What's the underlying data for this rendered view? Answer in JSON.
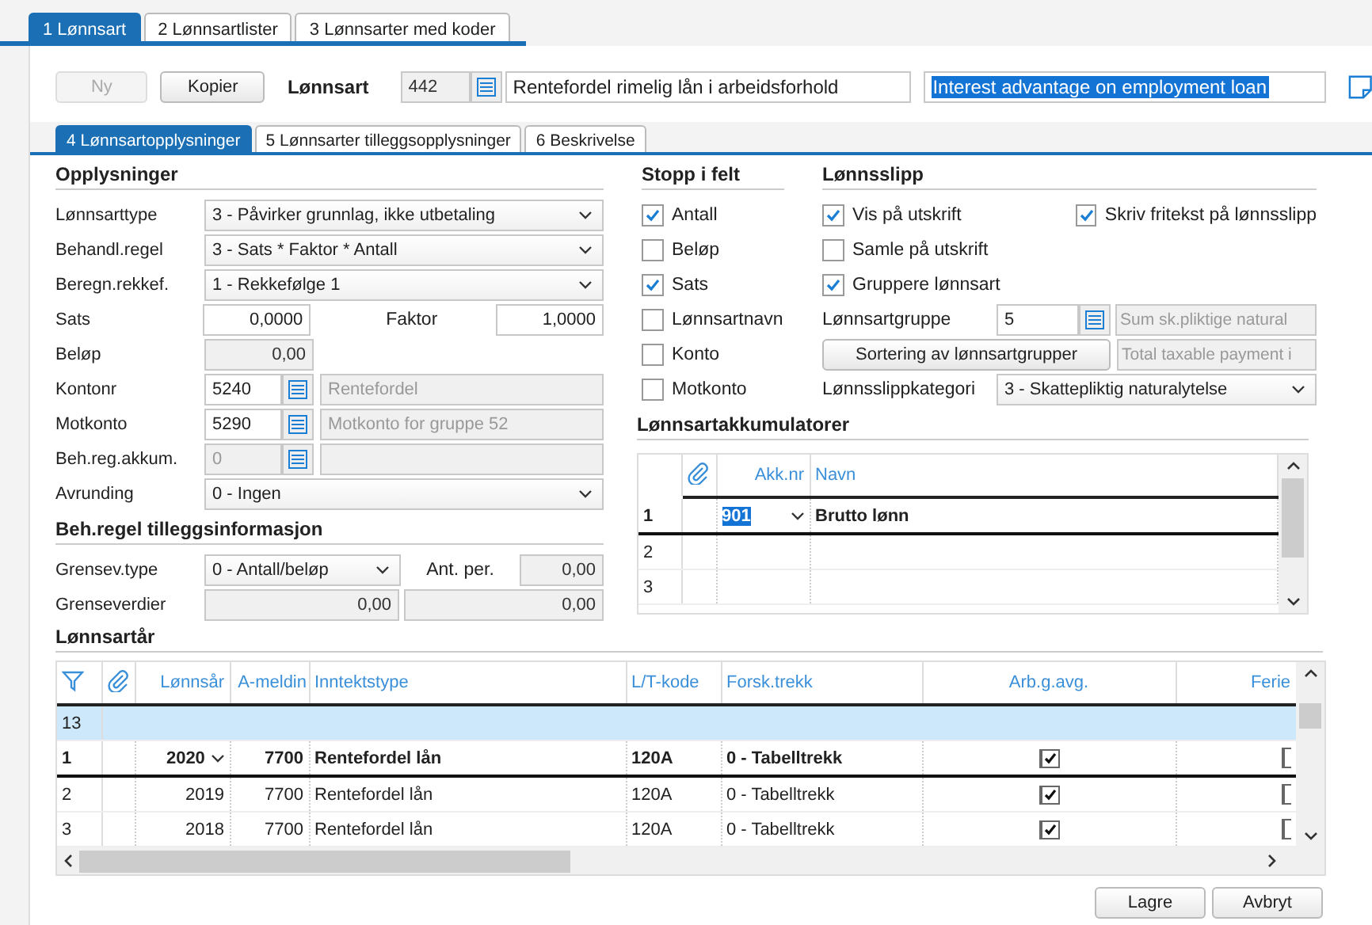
{
  "tabs": [
    {
      "label": "1 Lønnsart",
      "selected": true
    },
    {
      "label": "2 Lønnsartlister",
      "selected": false
    },
    {
      "label": "3 Lønnsarter med koder",
      "selected": false
    }
  ],
  "header": {
    "new_button": {
      "label": "Ny",
      "disabled": true
    },
    "copy_button": {
      "label": "Kopier",
      "disabled": false
    },
    "label": "Lønnsart",
    "code": "442",
    "name": "Rentefordel rimelig lån i arbeidsforhold",
    "english_name": "Interest advantage on employment loan"
  },
  "subtabs": [
    {
      "label": "4 Lønnsartopplysninger",
      "selected": true
    },
    {
      "label": "5 Lønnsarter tilleggsopplysninger",
      "selected": false
    },
    {
      "label": "6 Beskrivelse",
      "selected": false
    }
  ],
  "info": {
    "title": "Opplysninger",
    "rows": [
      {
        "kind": "select",
        "label": "Lønnsarttype",
        "value": "3 - Påvirker grunnlag, ikke utbetaling"
      },
      {
        "kind": "select",
        "label": "Behandl.regel",
        "value": "3 - Sats * Faktor * Antall"
      },
      {
        "kind": "select",
        "label": "Beregn.rekkef.",
        "value": "1 - Rekkefølge 1"
      },
      {
        "kind": "pair",
        "label": "Sats",
        "value": "0,0000",
        "label2": "Faktor",
        "value2": "1,0000"
      },
      {
        "kind": "number",
        "label": "Beløp",
        "value": "0,00",
        "disabled": true
      },
      {
        "kind": "lookup",
        "label": "Kontonr",
        "value": "5240",
        "description": "Rentefordel",
        "disabled": false
      },
      {
        "kind": "lookup",
        "label": "Motkonto",
        "value": "5290",
        "description": "Motkonto for gruppe 52",
        "disabled": false
      },
      {
        "kind": "lookup",
        "label": "Beh.reg.akkum.",
        "value": "0",
        "disabled": true
      },
      {
        "kind": "select",
        "label": "Avrunding",
        "value": "0 - Ingen"
      }
    ]
  },
  "rule_info": {
    "title": "Beh.regel tilleggsinformasjon",
    "limit_type": {
      "label": "Grensev.type",
      "value": "0 - Antall/beløp"
    },
    "periods": {
      "label": "Ant. per.",
      "value": "0,00"
    },
    "limits": {
      "label": "Grenseverdier",
      "values": [
        "0,00",
        "0,00"
      ]
    }
  },
  "stop_fields": {
    "title": "Stopp i felt",
    "items": [
      {
        "label": "Antall",
        "checked": true
      },
      {
        "label": "Beløp",
        "checked": false
      },
      {
        "label": "Sats",
        "checked": true
      },
      {
        "label": "Lønnsartnavn",
        "checked": false
      },
      {
        "label": "Konto",
        "checked": false
      },
      {
        "label": "Motkonto",
        "checked": false
      }
    ]
  },
  "payslip": {
    "title": "Lønnsslipp",
    "checks": [
      {
        "label": "Vis på utskrift",
        "checked": true
      },
      {
        "label": "Skriv fritekst på lønnsslipp",
        "checked": true
      },
      {
        "label": "Samle på utskrift",
        "checked": false
      },
      {
        "label": "Gruppere lønnsart",
        "checked": true
      }
    ],
    "group": {
      "label": "Lønnsartgruppe",
      "value": "5",
      "description": "Sum sk.pliktige natural"
    },
    "sort_button": "Sortering av lønnsartgrupper",
    "english_description": "Total taxable payment i",
    "category": {
      "label": "Lønnsslippkategori",
      "value": "3 - Skattepliktig naturalytelse"
    }
  },
  "accumulators": {
    "title": "Lønnsartakkumulatorer",
    "columns": [
      "Akk.nr",
      "Navn"
    ],
    "rows": [
      {
        "number": "1",
        "akk_nr": "901",
        "name": "Brutto lønn",
        "selected": true
      },
      {
        "number": "2",
        "selected": false
      },
      {
        "number": "3",
        "selected": false
      }
    ]
  },
  "years": {
    "title": "Lønnsartår",
    "columns": [
      "Lønnsår",
      "A-meldin",
      "Inntektstype",
      "L/T-kode",
      "Forsk.trekk",
      "Arb.g.avg.",
      "Ferie"
    ],
    "new_row": "13",
    "rows": [
      {
        "number": "1",
        "year": "2020",
        "a_melding": "7700",
        "income_type": "Rentefordel lån",
        "lt_code": "120A",
        "deduction": "0 - Tabelltrekk",
        "employer_tax": true,
        "selected": true
      },
      {
        "number": "2",
        "year": "2019",
        "a_melding": "7700",
        "income_type": "Rentefordel lån",
        "lt_code": "120A",
        "deduction": "0 - Tabelltrekk",
        "employer_tax": true,
        "selected": false
      },
      {
        "number": "3",
        "year": "2018",
        "a_melding": "7700",
        "income_type": "Rentefordel lån",
        "lt_code": "120A",
        "deduction": "0 - Tabelltrekk",
        "employer_tax": true,
        "selected": false
      }
    ]
  },
  "buttons": [
    "Lagre",
    "Avbryt"
  ]
}
